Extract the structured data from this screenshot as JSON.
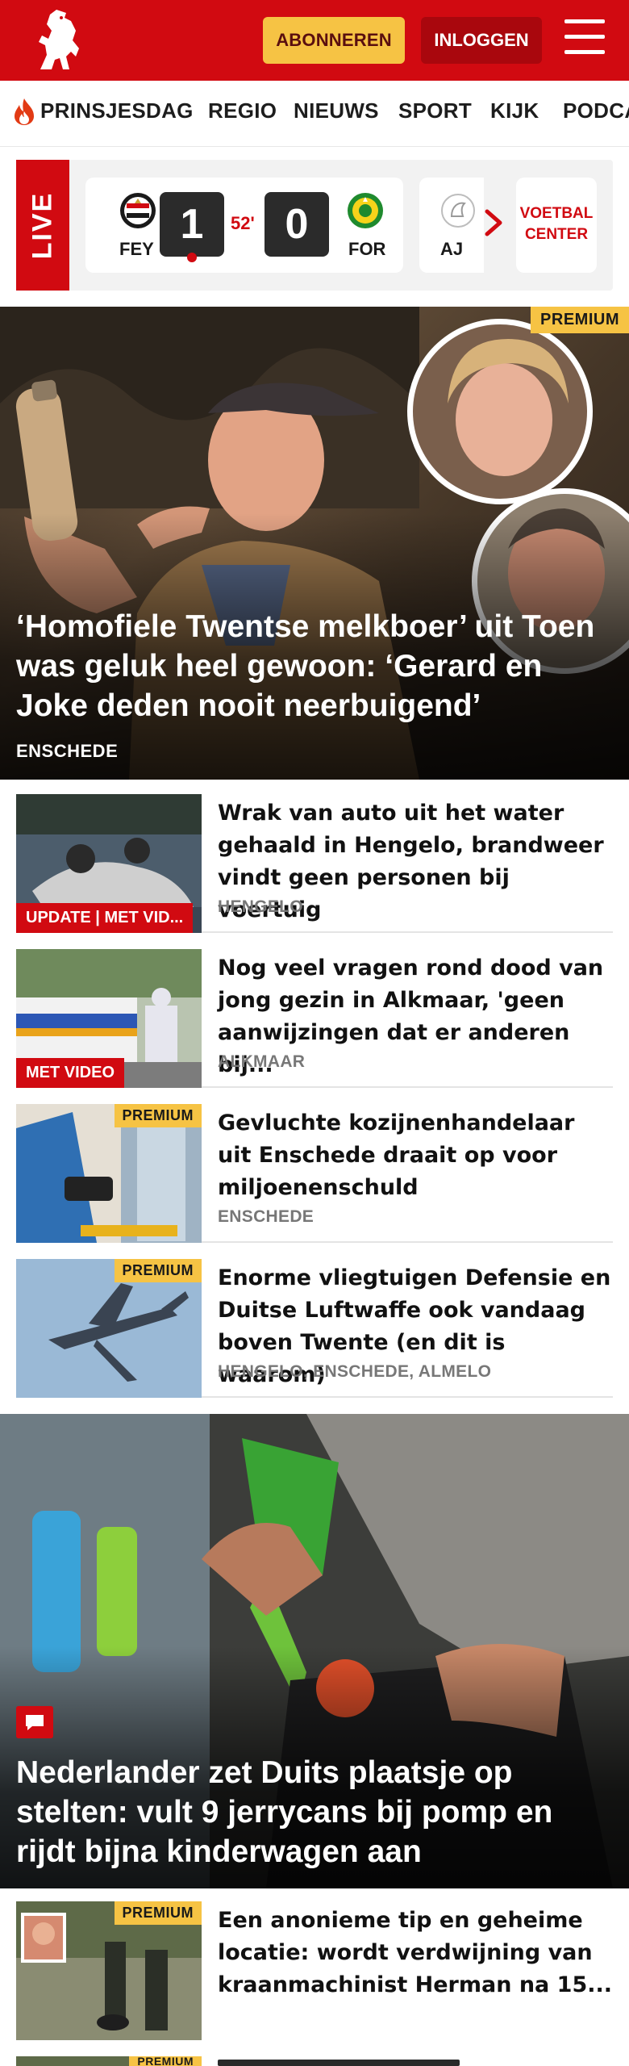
{
  "header": {
    "subscribe_label": "ABONNEREN",
    "login_label": "INLOGGEN",
    "brand_color": "#d10a11",
    "subscribe_color": "#f6c344"
  },
  "nav": {
    "items": [
      "PRINSJESDAG",
      "REGIO",
      "NIEUWS",
      "SPORT",
      "KIJK",
      "PODCA"
    ]
  },
  "live": {
    "label": "LIVE",
    "match": {
      "home_code": "FEY",
      "away_code": "FOR",
      "home_score": "1",
      "away_score": "0",
      "minute": "52'"
    },
    "next_match_code": "AJ",
    "voetbal_center_line1": "VOETBAL",
    "voetbal_center_line2": "CENTER"
  },
  "hero": {
    "badge": "PREMIUM",
    "title": "‘Homofiele Twentse melkboer’ uit Toen was geluk heel gewoon: ‘Gerard en Joke deden nooit neerbuigend’",
    "location": "ENSCHEDE"
  },
  "articles": [
    {
      "label": "UPDATE | MET VID...",
      "title": "Wrak van auto uit het water gehaald in Hengelo, brandweer vindt geen personen bij voertuig",
      "location": "HENGELO"
    },
    {
      "label": "MET VIDEO",
      "title": "Nog veel vragen rond dood van jong gezin in Alkmaar, 'geen aanwijzingen dat er anderen bij...",
      "location": "ALKMAAR"
    },
    {
      "badge": "PREMIUM",
      "title": "Gevluchte kozijnenhandelaar uit Enschede draait op voor miljoenenschuld",
      "location": "ENSCHEDE"
    },
    {
      "badge": "PREMIUM",
      "title": "Enorme vliegtuigen Defensie en Duitse Luftwaffe ook vandaag boven Twente (en dit is waarom)",
      "location": "HENGELO, ENSCHEDE, ALMELO"
    }
  ],
  "big_article": {
    "title": "Nederlander zet Duits plaatsje op stelten: vult 9 jerrycans bij pomp en rijdt bijna kinderwagen aan"
  },
  "bottom_article": {
    "badge": "PREMIUM",
    "title": "Een anonieme tip en geheime locatie: wordt verdwijning van kraanmachinist Herman na 15..."
  },
  "peek_article": {
    "badge": "PREMIUM"
  }
}
